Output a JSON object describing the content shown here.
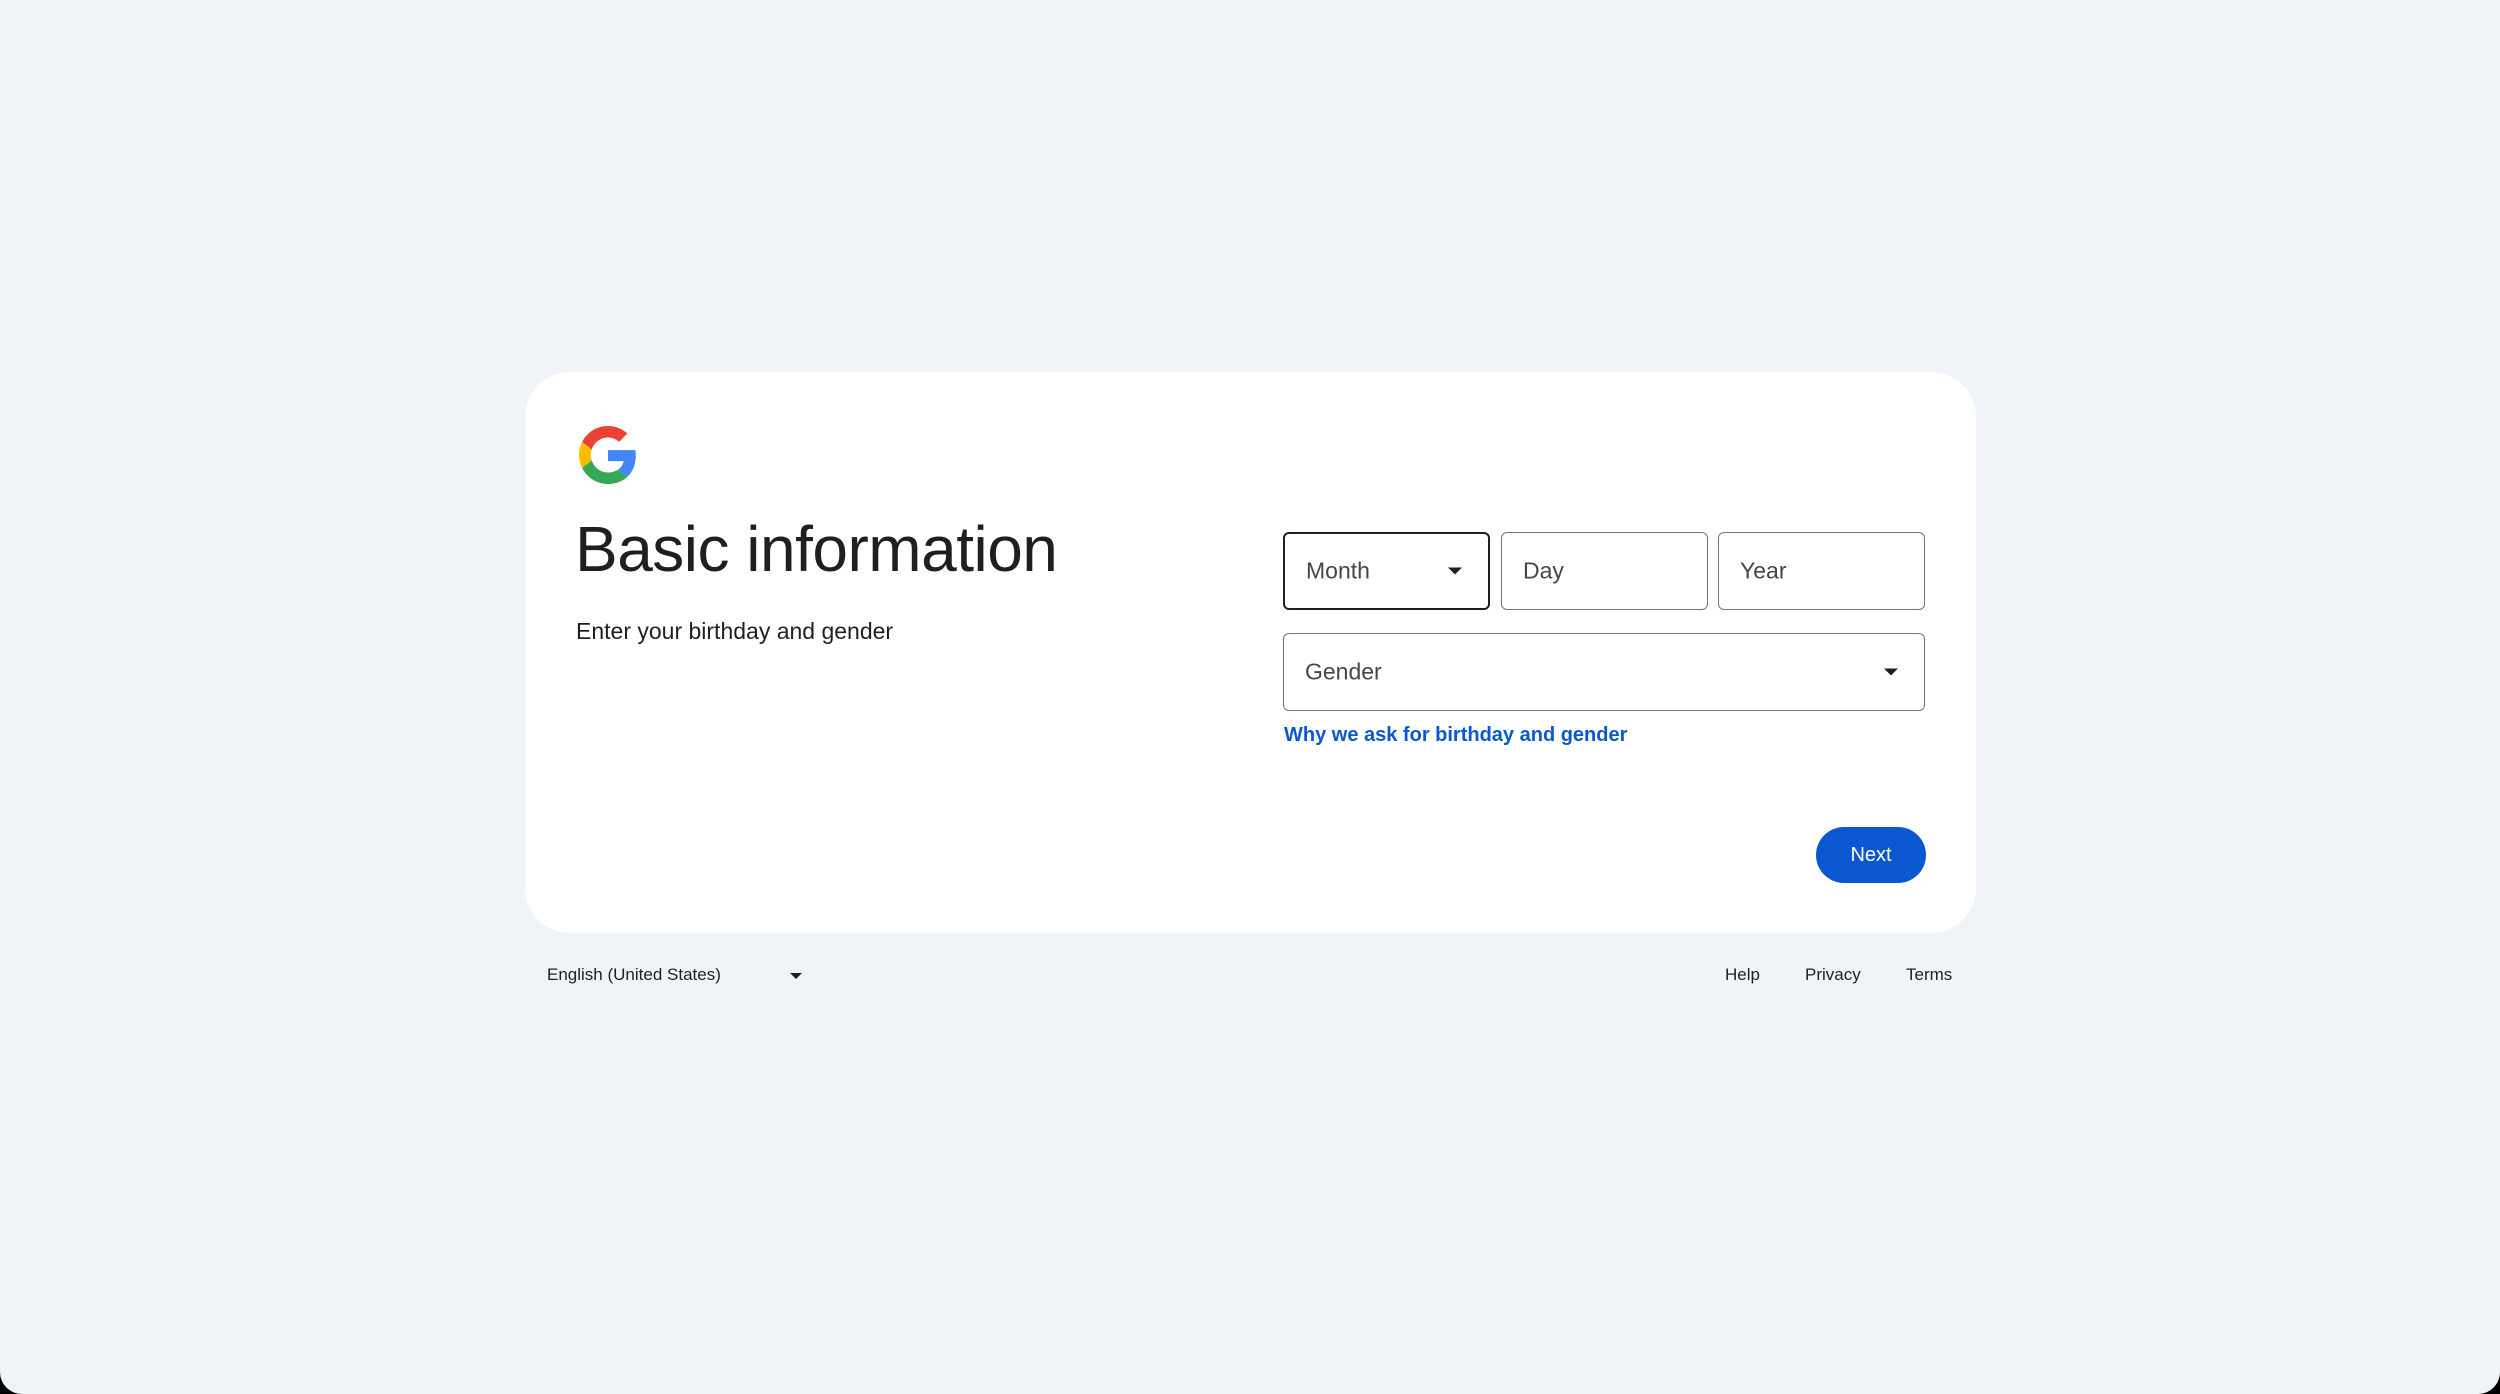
{
  "brand": {
    "logo_icon": "google-g-logo-icon",
    "colors": {
      "blue": "#4285F4",
      "red": "#EA4335",
      "yellow": "#FBBC05",
      "green": "#34A853",
      "accent": "#0b57d0",
      "background": "#f0f4f9"
    }
  },
  "header": {
    "title": "Basic information",
    "subtitle": "Enter your birthday and gender"
  },
  "form": {
    "month": {
      "value": "Month",
      "icon": "chevron-down-icon"
    },
    "day": {
      "placeholder": "Day"
    },
    "year": {
      "placeholder": "Year"
    },
    "gender": {
      "value": "Gender",
      "icon": "chevron-down-icon"
    },
    "why_link": "Why we ask for birthday and gender",
    "next_label": "Next"
  },
  "footer": {
    "language": "English (United States)",
    "language_icon": "chevron-down-icon",
    "links": {
      "help": "Help",
      "privacy": "Privacy",
      "terms": "Terms"
    }
  }
}
